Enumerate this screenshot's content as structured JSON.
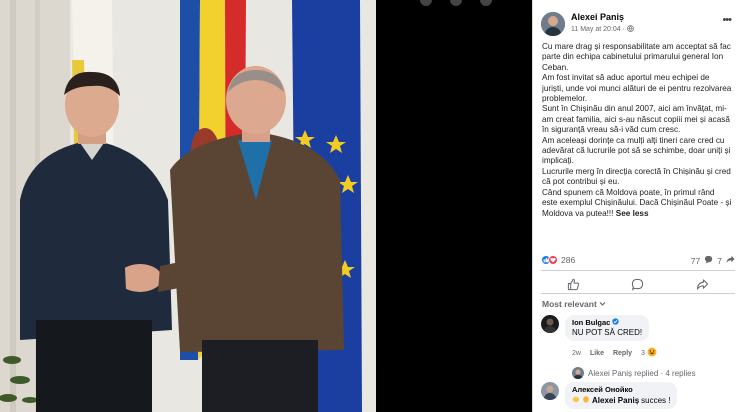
{
  "post": {
    "author": "Alexei Paniș",
    "timestamp": "11 May at 20:04 ·",
    "paragraphs": [
      "Cu mare drag și responsabilitate am acceptat să fac parte din echipa cabinetului primarului general Ion Ceban.",
      "Am fost invitat să aduc aportul meu echipei de juriști, unde voi munci alături de ei pentru rezolvarea problemelor.",
      "Sunt în Chișinău din anul 2007, aici am învățat, mi-am creat familia, aici s-au născut copiii mei și acasă în siguranță vreau să-i văd cum cresc.",
      "Am aceleași dorințe ca mulți alți tineri care cred cu adevărat că lucrurile pot să se schimbe, doar uniți și implicați.",
      "Lucrurile merg în direcția corectă în Chișinău și cred că pot contribui și eu."
    ],
    "last_paragraph": "Când spunem că Moldova poate, în primul rând este exemplul Chișinăului. Dacă Chișinăul Poate - și Moldova va putea!!!",
    "see_less": "See less"
  },
  "stats": {
    "reactions": "286",
    "comments": "77",
    "shares": "7"
  },
  "comments_header": "Most relevant",
  "comments": [
    {
      "author": "Ion Bulgac",
      "text": "NU POT SĂ CRED!",
      "age": "2w",
      "like": "Like",
      "reply": "Reply",
      "reactions": "3",
      "replies_line": "Alexei Paniș replied · 4 replies"
    },
    {
      "author": "Алексей Онойко",
      "mention": "Alexei Paniș",
      "text": "succes !"
    }
  ],
  "colors": {
    "like_blue": "#1877f2",
    "love_red": "#f33e58",
    "verified": "#1877f2"
  },
  "icons": [
    "more-icon",
    "globe-icon",
    "like-icon",
    "love-icon",
    "comment-icon",
    "share-icon",
    "verified-icon"
  ]
}
